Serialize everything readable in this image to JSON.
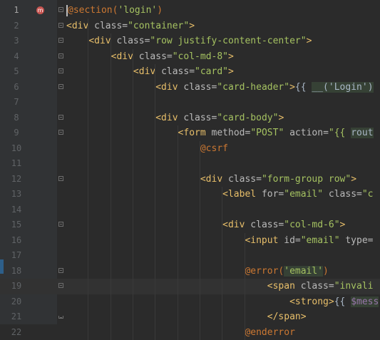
{
  "editor": {
    "lines": [
      {
        "n": "1",
        "tokens": [
          {
            "c": "t-dir",
            "t": "@section("
          },
          {
            "c": "t-str",
            "t": "'login'"
          },
          {
            "c": "t-dir",
            "t": ")"
          }
        ]
      },
      {
        "n": "2",
        "tokens": [
          {
            "c": "t-tag",
            "t": "<div "
          },
          {
            "c": "t-attr",
            "t": "class="
          },
          {
            "c": "t-str",
            "t": "\"container\""
          },
          {
            "c": "t-tag",
            "t": ">"
          }
        ]
      },
      {
        "n": "3",
        "tokens": [
          {
            "c": "t-plain",
            "t": "    "
          },
          {
            "c": "t-tag",
            "t": "<div "
          },
          {
            "c": "t-attr",
            "t": "class="
          },
          {
            "c": "t-str",
            "t": "\"row justify-content-center\""
          },
          {
            "c": "t-tag",
            "t": ">"
          }
        ]
      },
      {
        "n": "4",
        "tokens": [
          {
            "c": "t-plain",
            "t": "        "
          },
          {
            "c": "t-tag",
            "t": "<div "
          },
          {
            "c": "t-attr",
            "t": "class="
          },
          {
            "c": "t-str",
            "t": "\"col-md-8\""
          },
          {
            "c": "t-tag",
            "t": ">"
          }
        ]
      },
      {
        "n": "5",
        "tokens": [
          {
            "c": "t-plain",
            "t": "            "
          },
          {
            "c": "t-tag",
            "t": "<div "
          },
          {
            "c": "t-attr",
            "t": "class="
          },
          {
            "c": "t-str",
            "t": "\"card\""
          },
          {
            "c": "t-tag",
            "t": ">"
          }
        ]
      },
      {
        "n": "6",
        "tokens": [
          {
            "c": "t-plain",
            "t": "                "
          },
          {
            "c": "t-tag",
            "t": "<div "
          },
          {
            "c": "t-attr",
            "t": "class="
          },
          {
            "c": "t-str",
            "t": "\"card-header\""
          },
          {
            "c": "t-tag",
            "t": ">"
          },
          {
            "c": "t-plain",
            "t": "{{ "
          },
          {
            "c": "t-inj",
            "t": "__("
          },
          {
            "c": "t-inj t-str",
            "t": "'Login'"
          },
          {
            "c": "t-inj",
            "t": ")"
          }
        ]
      },
      {
        "n": "7",
        "tokens": []
      },
      {
        "n": "8",
        "tokens": [
          {
            "c": "t-plain",
            "t": "                "
          },
          {
            "c": "t-tag",
            "t": "<div "
          },
          {
            "c": "t-attr",
            "t": "class="
          },
          {
            "c": "t-str",
            "t": "\"card-body\""
          },
          {
            "c": "t-tag",
            "t": ">"
          }
        ]
      },
      {
        "n": "9",
        "tokens": [
          {
            "c": "t-plain",
            "t": "                    "
          },
          {
            "c": "t-tag",
            "t": "<form "
          },
          {
            "c": "t-attr",
            "t": "method="
          },
          {
            "c": "t-str",
            "t": "\"POST\""
          },
          {
            "c": "t-attr",
            "t": " action="
          },
          {
            "c": "t-str",
            "t": "\"{{ "
          },
          {
            "c": "t-inj",
            "t": "rout"
          }
        ]
      },
      {
        "n": "10",
        "tokens": [
          {
            "c": "t-plain",
            "t": "                        "
          },
          {
            "c": "t-dir",
            "t": "@csrf"
          }
        ]
      },
      {
        "n": "11",
        "tokens": []
      },
      {
        "n": "12",
        "tokens": [
          {
            "c": "t-plain",
            "t": "                        "
          },
          {
            "c": "t-tag",
            "t": "<div "
          },
          {
            "c": "t-attr",
            "t": "class="
          },
          {
            "c": "t-str",
            "t": "\"form-group row\""
          },
          {
            "c": "t-tag",
            "t": ">"
          }
        ]
      },
      {
        "n": "13",
        "tokens": [
          {
            "c": "t-plain",
            "t": "                            "
          },
          {
            "c": "t-tag",
            "t": "<label "
          },
          {
            "c": "t-attr",
            "t": "for="
          },
          {
            "c": "t-str",
            "t": "\"email\""
          },
          {
            "c": "t-attr",
            "t": " class="
          },
          {
            "c": "t-str",
            "t": "\"c"
          }
        ]
      },
      {
        "n": "14",
        "tokens": []
      },
      {
        "n": "15",
        "tokens": [
          {
            "c": "t-plain",
            "t": "                            "
          },
          {
            "c": "t-tag",
            "t": "<div "
          },
          {
            "c": "t-attr",
            "t": "class="
          },
          {
            "c": "t-str",
            "t": "\"col-md-6\""
          },
          {
            "c": "t-tag",
            "t": ">"
          }
        ]
      },
      {
        "n": "16",
        "tokens": [
          {
            "c": "t-plain",
            "t": "                                "
          },
          {
            "c": "t-tag",
            "t": "<input "
          },
          {
            "c": "t-attr",
            "t": "id="
          },
          {
            "c": "t-str",
            "t": "\"email\""
          },
          {
            "c": "t-attr",
            "t": " type="
          }
        ]
      },
      {
        "n": "17",
        "tokens": []
      },
      {
        "n": "18",
        "tokens": [
          {
            "c": "t-plain",
            "t": "                                "
          },
          {
            "c": "t-dir",
            "t": "@error("
          },
          {
            "c": "t-str str-hl",
            "t": "'email'"
          },
          {
            "c": "t-dir",
            "t": ")"
          }
        ]
      },
      {
        "n": "19",
        "tokens": [
          {
            "c": "t-plain",
            "t": "                                    "
          },
          {
            "c": "t-tag",
            "t": "<span "
          },
          {
            "c": "t-attr",
            "t": "class="
          },
          {
            "c": "t-str",
            "t": "\"invali"
          }
        ]
      },
      {
        "n": "20",
        "tokens": [
          {
            "c": "t-plain",
            "t": "                                        "
          },
          {
            "c": "t-tag",
            "t": "<strong>"
          },
          {
            "c": "t-plain",
            "t": "{{ "
          },
          {
            "c": "t-inj t-var",
            "t": "$mess"
          }
        ]
      },
      {
        "n": "21",
        "tokens": [
          {
            "c": "t-plain",
            "t": "                                    "
          },
          {
            "c": "t-tag",
            "t": "</span>"
          }
        ]
      },
      {
        "n": "22",
        "tokens": [
          {
            "c": "t-plain",
            "t": "                                "
          },
          {
            "c": "t-dir",
            "t": "@enderror"
          }
        ]
      }
    ]
  },
  "gutter": {
    "active_line": "1",
    "marker_label": "m",
    "fold_lines": [
      "1",
      "2",
      "3",
      "4",
      "5",
      "6",
      "8",
      "9",
      "12",
      "15",
      "18",
      "19",
      "21"
    ],
    "fold_end_lines": [
      "21"
    ]
  }
}
